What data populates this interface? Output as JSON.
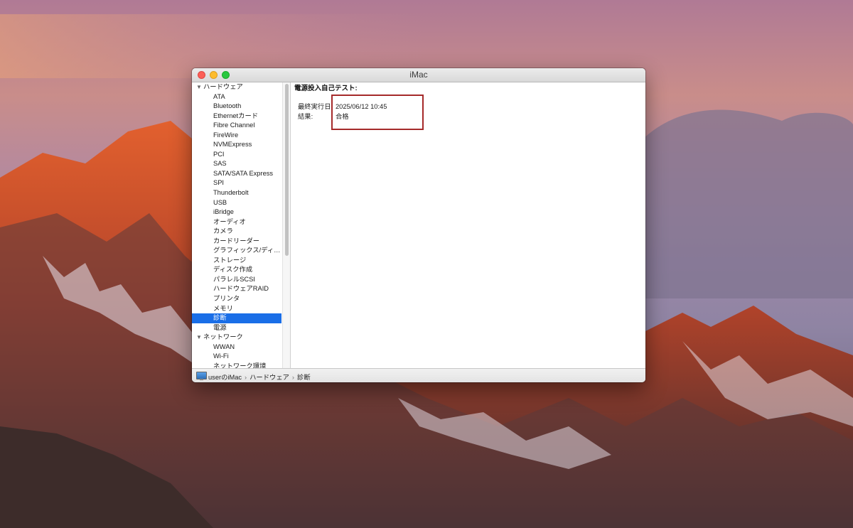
{
  "window": {
    "title": "iMac"
  },
  "sidebar": {
    "rows": [
      {
        "type": "group",
        "label": "ハードウェア",
        "expanded": true
      },
      {
        "type": "item",
        "label": "ATA"
      },
      {
        "type": "item",
        "label": "Bluetooth"
      },
      {
        "type": "item",
        "label": "Ethernetカード"
      },
      {
        "type": "item",
        "label": "Fibre Channel"
      },
      {
        "type": "item",
        "label": "FireWire"
      },
      {
        "type": "item",
        "label": "NVMExpress"
      },
      {
        "type": "item",
        "label": "PCI"
      },
      {
        "type": "item",
        "label": "SAS"
      },
      {
        "type": "item",
        "label": "SATA/SATA Express"
      },
      {
        "type": "item",
        "label": "SPI"
      },
      {
        "type": "item",
        "label": "Thunderbolt"
      },
      {
        "type": "item",
        "label": "USB"
      },
      {
        "type": "item",
        "label": "iBridge"
      },
      {
        "type": "item",
        "label": "オーディオ"
      },
      {
        "type": "item",
        "label": "カメラ"
      },
      {
        "type": "item",
        "label": "カードリーダー"
      },
      {
        "type": "item",
        "label": "グラフィックス/ディ…"
      },
      {
        "type": "item",
        "label": "ストレージ"
      },
      {
        "type": "item",
        "label": "ディスク作成"
      },
      {
        "type": "item",
        "label": "パラレルSCSI"
      },
      {
        "type": "item",
        "label": "ハードウェアRAID"
      },
      {
        "type": "item",
        "label": "プリンタ"
      },
      {
        "type": "item",
        "label": "メモリ"
      },
      {
        "type": "item",
        "label": "診断",
        "selected": true
      },
      {
        "type": "item",
        "label": "電源"
      },
      {
        "type": "group",
        "label": "ネットワーク",
        "expanded": true
      },
      {
        "type": "item",
        "label": "WWAN"
      },
      {
        "type": "item",
        "label": "Wi-Fi"
      },
      {
        "type": "item",
        "label": "ネットワーク環境"
      }
    ]
  },
  "detail": {
    "heading": "電源投入自己テスト:",
    "last_run_label": "最終実行日:",
    "last_run_value": "2025/06/12 10:45",
    "result_label": "結果:",
    "result_value": "合格"
  },
  "pathbar": {
    "items": [
      "userのiMac",
      "ハードウェア",
      "診断"
    ],
    "separator": "›"
  },
  "colors": {
    "selection": "#1a6ee7",
    "highlight_border": "#a52a2a"
  }
}
